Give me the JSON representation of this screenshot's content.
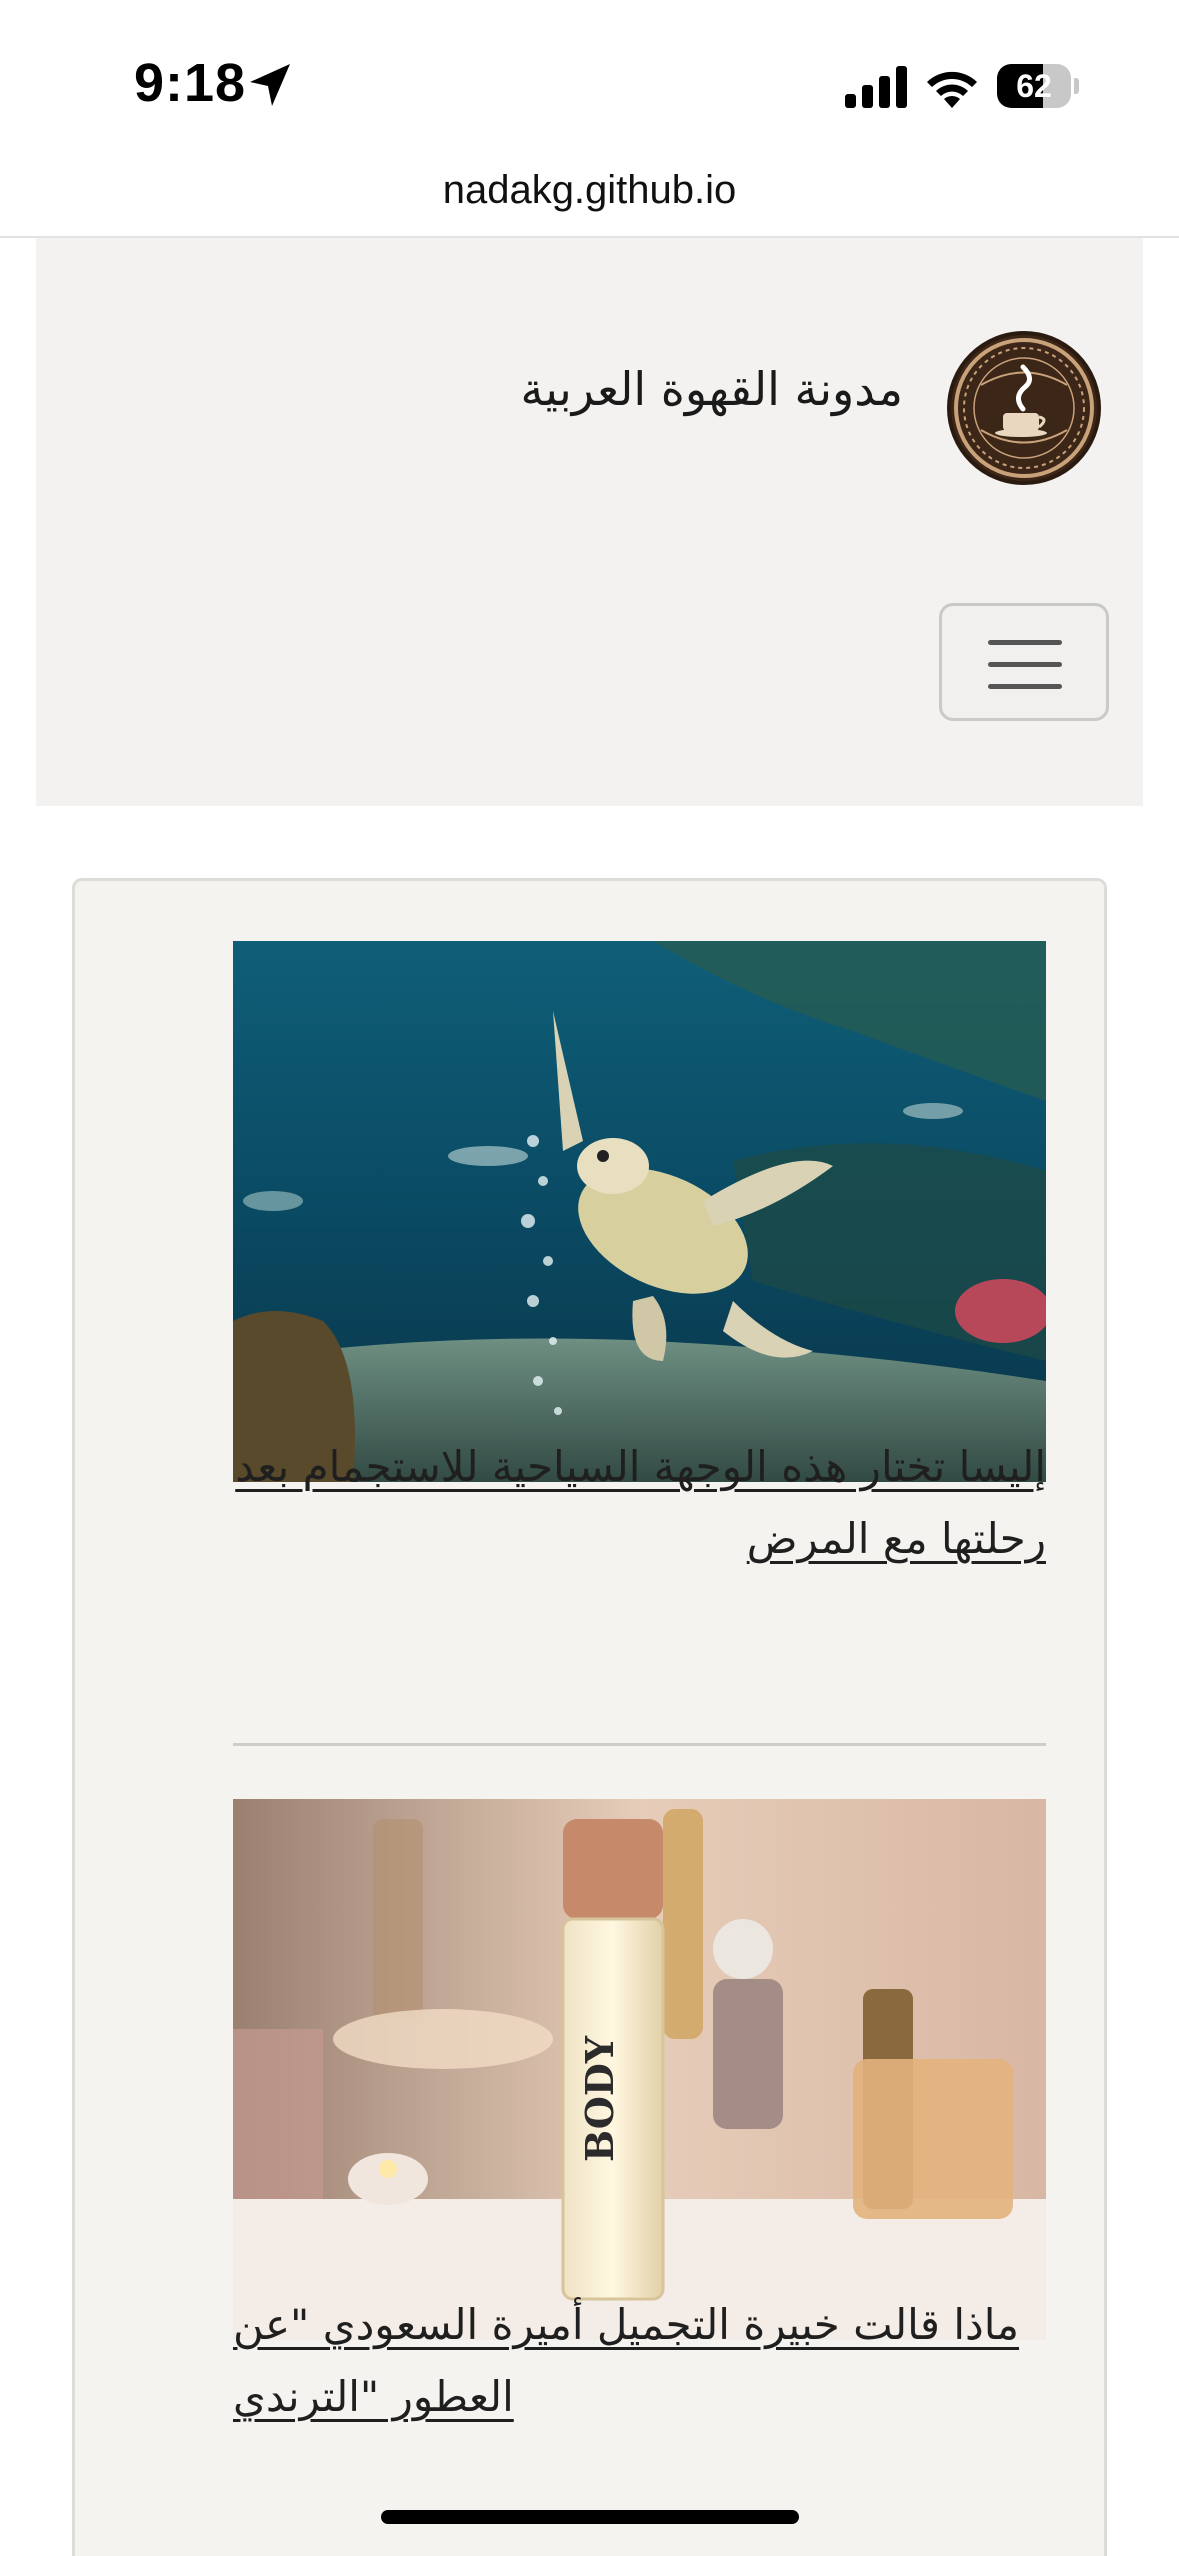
{
  "status_bar": {
    "time": "9:18",
    "battery_level": "62",
    "battery_fraction": 0.62,
    "icons": [
      "location-arrow-icon",
      "cellular-signal-icon",
      "wifi-icon",
      "battery-icon"
    ]
  },
  "browser": {
    "url": "nadakg.github.io"
  },
  "header": {
    "site_name": "مدونة القهوة العربية",
    "logo_icon": "coffee-cup-emblem-icon",
    "menu_icon": "hamburger-menu-icon"
  },
  "posts": [
    {
      "title": "إليسا تختار هذه الوجهة السياحية للاستجمام بعد رحلتها مع المرض",
      "image": "sea-turtle-underwater-photo"
    },
    {
      "title": "ماذا قالت خبيرة التجميل أميرة السعودي \"عن العطور \"الترندي",
      "image": "perfume-bottles-photo"
    }
  ],
  "colors": {
    "header_bg": "#f3f2f0",
    "card_bg": "#f5f3f0",
    "text": "#1f1f1f",
    "logo_brown": "#3b2618",
    "logo_gold": "#c9a27a"
  }
}
